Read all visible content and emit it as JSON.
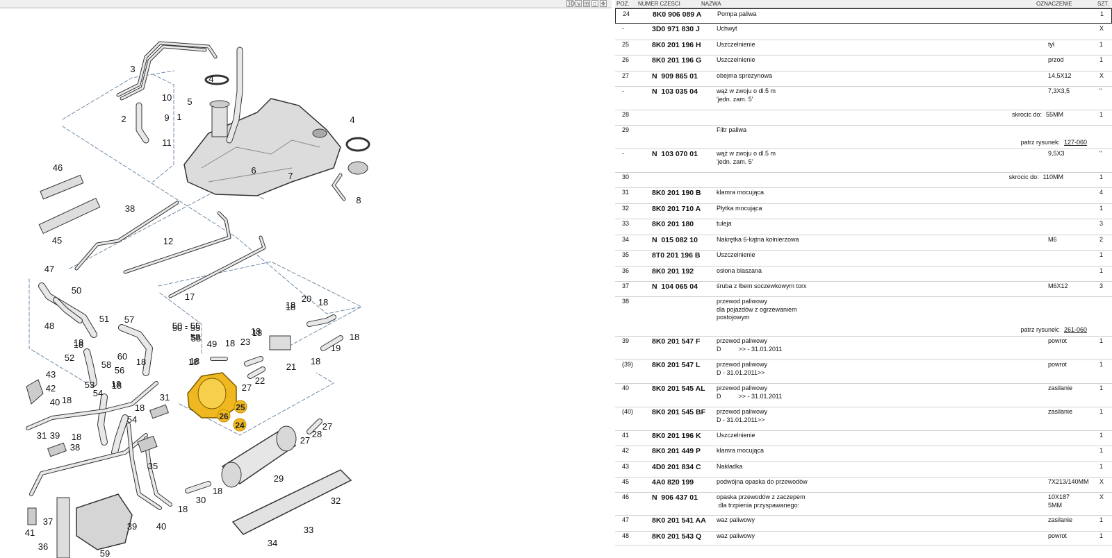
{
  "toolbar": {
    "buttons": [
      "3D",
      "scale-icon",
      "split-view-icon",
      "page-icon",
      "move-icon"
    ]
  },
  "diagram": {
    "callouts": [
      "1",
      "2",
      "3",
      "4",
      "5",
      "6",
      "7",
      "8",
      "9",
      "10",
      "11",
      "4",
      "12",
      "17",
      "18",
      "19",
      "20",
      "21",
      "22",
      "23",
      "24",
      "25",
      "26",
      "27",
      "28",
      "29",
      "30",
      "31",
      "32",
      "33",
      "34",
      "35",
      "36",
      "37",
      "38",
      "39",
      "40",
      "41",
      "42",
      "43",
      "45",
      "46",
      "47",
      "48",
      "49",
      "50",
      "51",
      "52",
      "53",
      "54",
      "56",
      "57",
      "58",
      "59",
      "60",
      "50 - 55",
      "58",
      "18",
      "18",
      "18",
      "18",
      "18",
      "18",
      "18",
      "18",
      "18",
      "18",
      "18",
      "31",
      "38",
      "39",
      "40",
      "27",
      "27",
      "18",
      "54"
    ],
    "highlighted": [
      "24",
      "25",
      "26"
    ],
    "accent_color": "#f0b820"
  },
  "table": {
    "headers": {
      "poz": "POZ.",
      "numer": "NUMER CZESCI",
      "nazwa": "NAZWA",
      "oznaczenie": "OZNACZENIE",
      "szt": "SZT."
    },
    "rows": [
      {
        "poz": "24",
        "num": "8K0 906 089 A",
        "name": [
          "Pompa paliwa"
        ],
        "ozn": "",
        "szt": "1",
        "selected": true
      },
      {
        "poz": "-",
        "num": "3D0 971 830 J",
        "name": [
          "Uchwyt"
        ],
        "ozn": "",
        "szt": "X"
      },
      {
        "poz": "25",
        "num": "8K0 201 196 H",
        "name": [
          "Uszczelnienie"
        ],
        "ozn": "tył",
        "szt": "1"
      },
      {
        "poz": "26",
        "num": "8K0 201 196 G",
        "name": [
          "Uszczelnienie"
        ],
        "ozn": "przod",
        "szt": "1"
      },
      {
        "poz": "27",
        "num": "N  909 865 01",
        "name": [
          "obejma sprezynowa"
        ],
        "ozn": "14,5X12",
        "szt": "X"
      },
      {
        "poz": "-",
        "num": "N  103 035 04",
        "name": [
          "wąż w zwoju o dl.5 m",
          "'jedn. zam. 5'"
        ],
        "ozn": "7,3X3,5",
        "szt": "\""
      },
      {
        "poz": "28",
        "num": "",
        "name": [],
        "right_label": "skrocic do:",
        "right_value": "55MM",
        "ozn": "",
        "szt": "1"
      },
      {
        "poz": "29",
        "num": "",
        "name": [
          "Filtr paliwa"
        ],
        "right_label": "patrz rysunek:",
        "right_link": "127-060",
        "ozn": "",
        "szt": ""
      },
      {
        "poz": "-",
        "num": "N  103 070 01",
        "name": [
          "wąż w zwoju o dl.5 m",
          "'jedn. zam. 5'"
        ],
        "ozn": "9,5X3",
        "szt": "\""
      },
      {
        "poz": "30",
        "num": "",
        "name": [],
        "right_label": "skrocic do:",
        "right_value": "110MM",
        "ozn": "",
        "szt": "1"
      },
      {
        "poz": "31",
        "num": "8K0 201 190 B",
        "name": [
          "klamra mocująca"
        ],
        "ozn": "",
        "szt": "4"
      },
      {
        "poz": "32",
        "num": "8K0 201 710 A",
        "name": [
          "Płytka mocująca"
        ],
        "ozn": "",
        "szt": "1"
      },
      {
        "poz": "33",
        "num": "8K0 201 180",
        "name": [
          "tuleja"
        ],
        "ozn": "",
        "szt": "3"
      },
      {
        "poz": "34",
        "num": "N  015 082 10",
        "name": [
          "Nakrętka 6-kątna kołnierzowa"
        ],
        "ozn": "M6",
        "szt": "2"
      },
      {
        "poz": "35",
        "num": "8T0 201 196 B",
        "name": [
          "Uszczelnienie"
        ],
        "ozn": "",
        "szt": "1"
      },
      {
        "poz": "36",
        "num": "8K0 201 192",
        "name": [
          "osłona blaszana"
        ],
        "ozn": "",
        "szt": "1"
      },
      {
        "poz": "37",
        "num": "N  104 065 04",
        "name": [
          "śruba z łbem soczewkowym torx"
        ],
        "ozn": "M6X12",
        "szt": "3"
      },
      {
        "poz": "38",
        "num": "",
        "name": [
          "przewod paliwowy",
          "dla pojazdów z ogrzewaniem",
          "postojowym"
        ],
        "right_label": "patrz rysunek:",
        "right_link": "261-060",
        "ozn": "",
        "szt": ""
      },
      {
        "poz": "39",
        "num": "8K0 201 547 F",
        "name": [
          "przewod paliwowy",
          "D          >> - 31.01.2011"
        ],
        "ozn": "powrot",
        "szt": "1"
      },
      {
        "poz": "(39)",
        "num": "8K0 201 547 L",
        "name": [
          "przewod paliwowy",
          "D - 31.01.2011>>"
        ],
        "ozn": "powrot",
        "szt": "1"
      },
      {
        "poz": "40",
        "num": "8K0 201 545 AL",
        "name": [
          "przewod paliwowy",
          "D          >> - 31.01.2011"
        ],
        "ozn": "zasilanie",
        "szt": "1"
      },
      {
        "poz": "(40)",
        "num": "8K0 201 545 BF",
        "name": [
          "przewod paliwowy",
          "D - 31.01.2011>>"
        ],
        "ozn": "zasilanie",
        "szt": "1"
      },
      {
        "poz": "41",
        "num": "8K0 201 196 K",
        "name": [
          "Uszczelnienie"
        ],
        "ozn": "",
        "szt": "1"
      },
      {
        "poz": "42",
        "num": "8K0 201 449 P",
        "name": [
          "klamra mocująca"
        ],
        "ozn": "",
        "szt": "1"
      },
      {
        "poz": "43",
        "num": "4D0 201 834 C",
        "name": [
          "Nakładka"
        ],
        "ozn": "",
        "szt": "1"
      },
      {
        "poz": "45",
        "num": "4A0 820 199",
        "name": [
          "podwójna opaska do przewodów"
        ],
        "ozn": "7X213/140MM",
        "szt": "X"
      },
      {
        "poz": "46",
        "num": "N  906 437 01",
        "name": [
          "opaska przewodów z zaczepem",
          " dla trzpienia przyspawanego:"
        ],
        "ozn": "10X187\n5MM",
        "szt": "X"
      },
      {
        "poz": "47",
        "num": "8K0 201 541 AA",
        "name": [
          "waz paliwowy"
        ],
        "ozn": "zasilanie",
        "szt": "1"
      },
      {
        "poz": "48",
        "num": "8K0 201 543 Q",
        "name": [
          "waz paliwowy"
        ],
        "ozn": "powrot",
        "szt": "1"
      }
    ]
  }
}
